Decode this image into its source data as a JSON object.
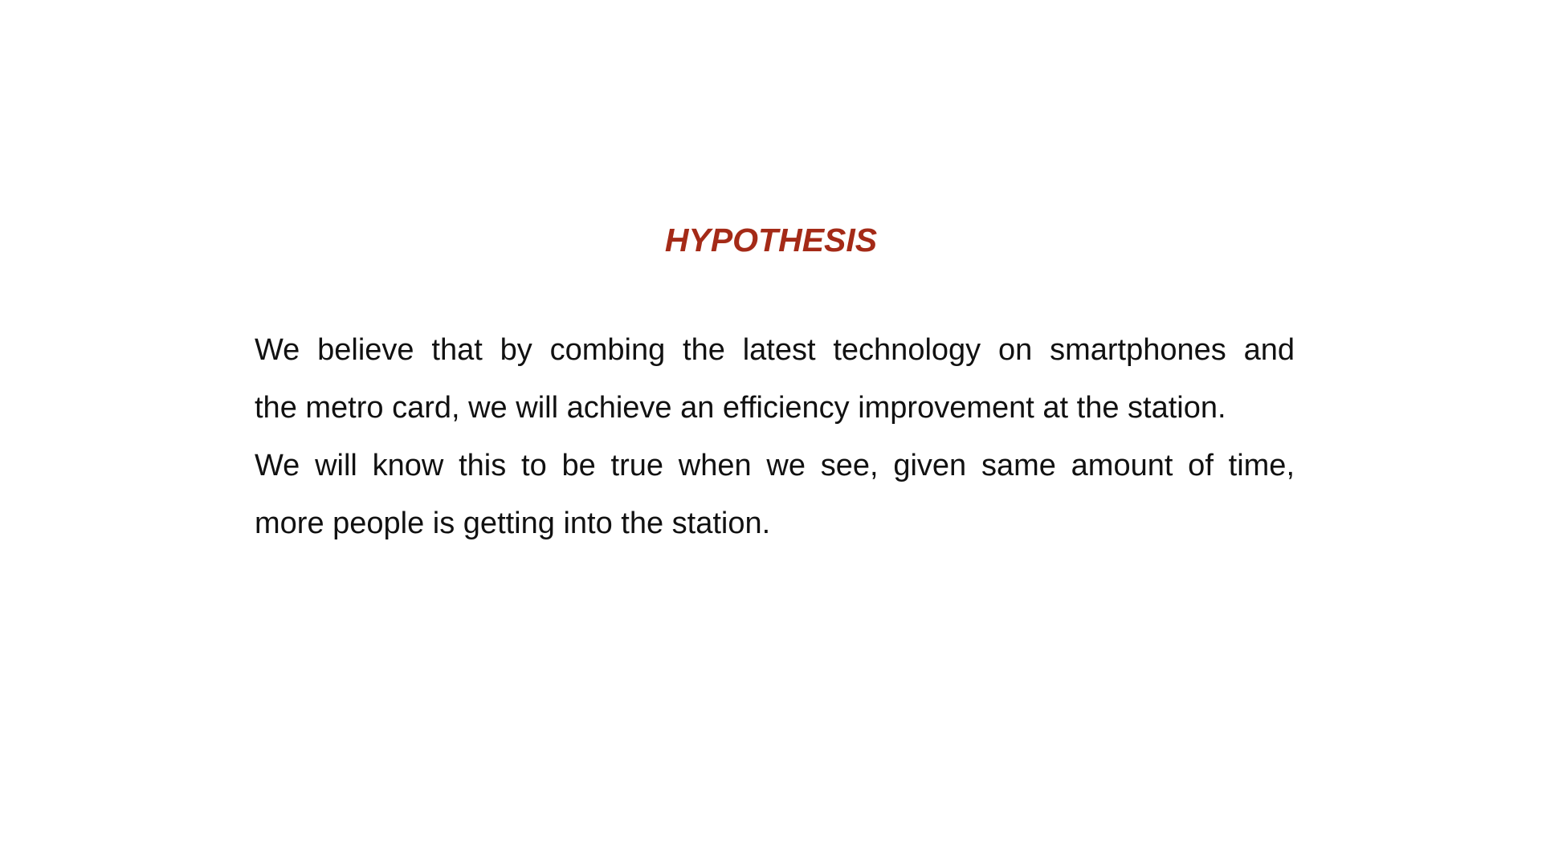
{
  "slide": {
    "title": "HYPOTHESIS",
    "title_color": "#a42a17",
    "text_color": "#111111",
    "background_color": "#ffffff",
    "body_lines": [
      "We believe that by combing the latest technology on smartphones and",
      "the metro card, we will achieve an efficiency improvement at the station.",
      "We will know this to be true when we see, given same amount of time,",
      "more people is getting into the station."
    ]
  }
}
